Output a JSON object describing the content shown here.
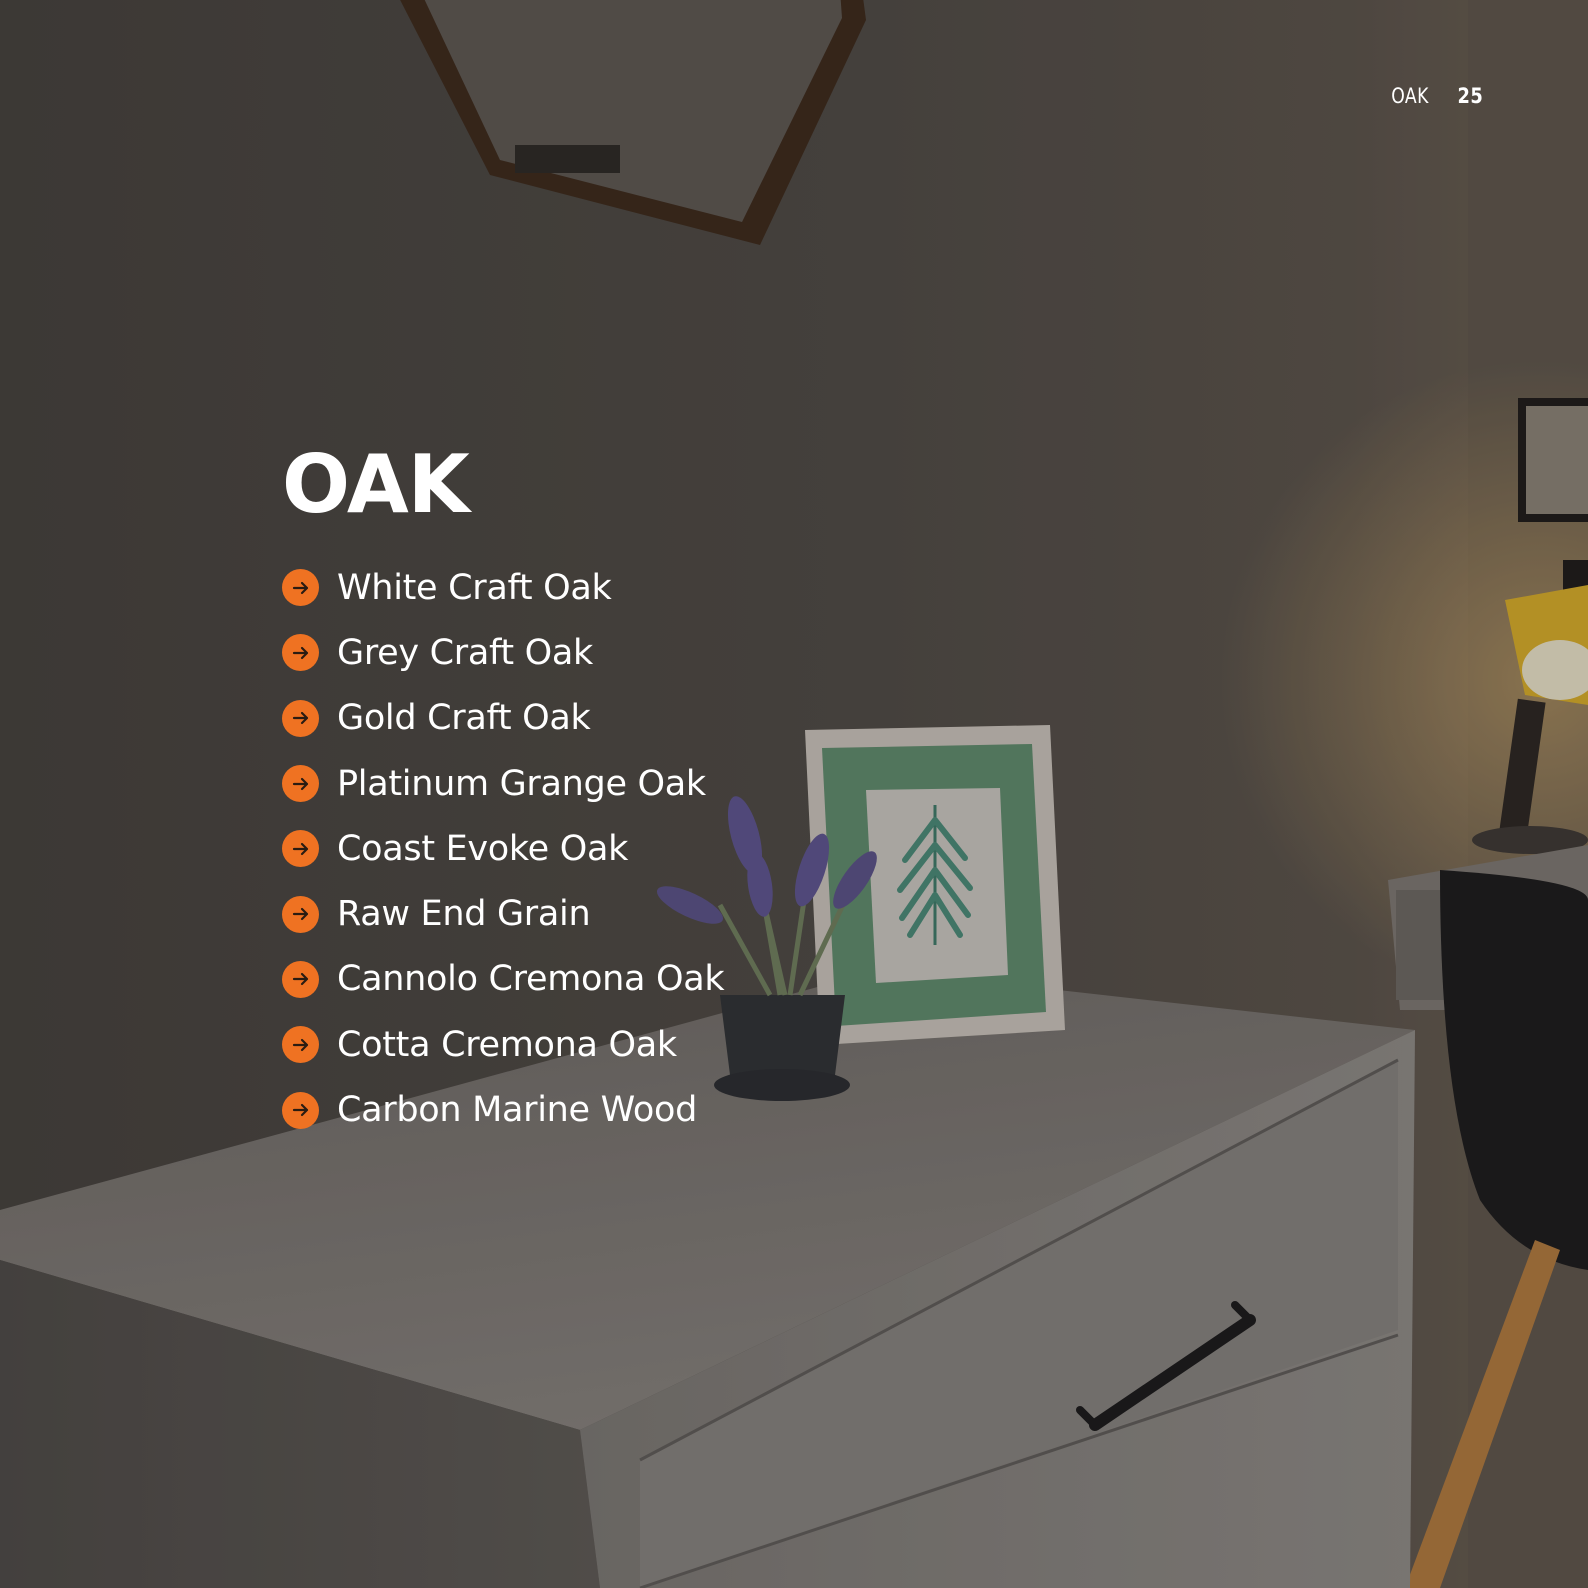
{
  "header": {
    "section": "OAK",
    "page_number": "25"
  },
  "title": "OAK",
  "finishes": [
    {
      "label": "White Craft Oak"
    },
    {
      "label": "Grey Craft Oak"
    },
    {
      "label": "Gold Craft Oak"
    },
    {
      "label": "Platinum Grange Oak"
    },
    {
      "label": "Coast Evoke Oak"
    },
    {
      "label": "Raw End Grain"
    },
    {
      "label": "Cannolo Cremona Oak"
    },
    {
      "label": "Cotta Cremona Oak"
    },
    {
      "label": "Carbon Marine Wood"
    }
  ],
  "colors": {
    "accent": "#ef7222",
    "text": "#ffffff",
    "wall": "#4c4843"
  },
  "icons": {
    "bullet": "arrow-right-circle-icon"
  }
}
